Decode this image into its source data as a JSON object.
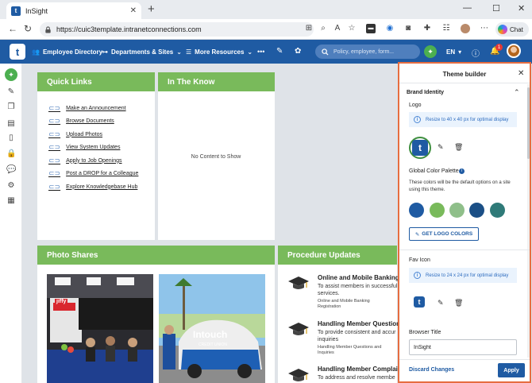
{
  "browser": {
    "tab_title": "InSight",
    "tab_close": "✕",
    "new_tab": "+",
    "url": "https://cuic3template.intranetconnections.com",
    "chat_label": "Chat",
    "window_controls": [
      "—",
      "☐",
      "✕"
    ]
  },
  "header": {
    "logo_letter": "t",
    "nav": [
      {
        "label": "Employee Directory",
        "icon": "people-icon"
      },
      {
        "label": "Departments & Sites",
        "icon": "org-chart-icon"
      },
      {
        "label": "More Resources",
        "icon": "list-icon"
      }
    ],
    "more": "•••",
    "search_placeholder": "Policy, employee, form...",
    "language": "EN",
    "notification_count": "1"
  },
  "quick_links": {
    "title": "Quick Links",
    "items": [
      "Make an Announcement",
      "Browse Documents",
      "Upload Photos",
      "View System Updates",
      "Apply to Job Openings",
      "Post a DROP for a Colleague",
      "Explore Knowledgebase Hub"
    ]
  },
  "in_the_know": {
    "title": "In The Know",
    "empty": "No Content to Show"
  },
  "photo_shares": {
    "title": "Photo Shares",
    "photo1_banner": "jiffy",
    "photo2_car_text": "Intouch",
    "photo2_car_sub": "CREDIT UNION"
  },
  "procedure_updates": {
    "title": "Procedure Updates",
    "items": [
      {
        "title": "Online and Mobile Banking R",
        "desc1": "To assist members in successful",
        "desc2": "services.",
        "tag1": "Online and Mobile Banking",
        "tag2": "Registration"
      },
      {
        "title": "Handling Member Questions",
        "desc1": "To provide consistent and accur",
        "desc2": "inquiries",
        "tag1": "Handling Member Questions and",
        "tag2": "Inquiries"
      },
      {
        "title": "Handling Member Complaints",
        "desc1": "To address and resolve membe",
        "desc2": "",
        "tag1": "",
        "tag2": ""
      }
    ]
  },
  "theme_builder": {
    "title": "Theme builder",
    "section": "Brand Identity",
    "logo_label": "Logo",
    "logo_info": "Resize to 40 x 40 px for optimal display",
    "palette_label": "Global Color Palette",
    "palette_desc": "These colors will be the default options on a site using this theme.",
    "swatches": [
      "#1f5ba3",
      "#79ba5b",
      "#8fbf8a",
      "#1b4f86",
      "#2f7a78"
    ],
    "get_logo_colors": "GET LOGO COLORS",
    "fav_label": "Fav Icon",
    "fav_info": "Resize to 24 x 24 px for optimal display",
    "browser_title_label": "Browser Title",
    "browser_title_value": "InSight",
    "discard": "Discard Changes",
    "apply": "Apply"
  },
  "colors": {
    "brand_blue": "#1f5ba3",
    "card_green": "#79ba5b",
    "accent_green": "#4caf50",
    "panel_border": "#e66d40"
  }
}
